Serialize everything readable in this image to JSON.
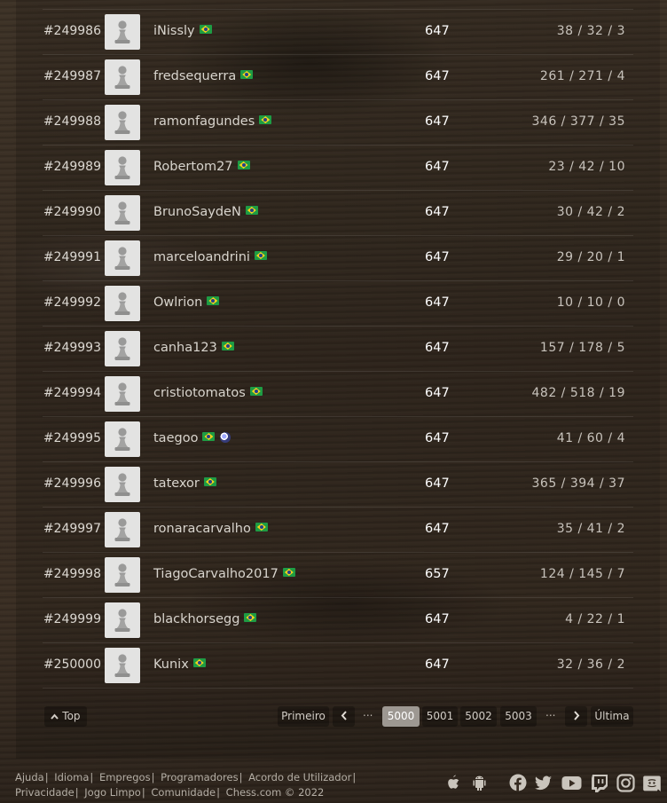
{
  "leaderboard": {
    "rows": [
      {
        "rank": "#249986",
        "username": "iNissly",
        "badge": false,
        "rating": "647",
        "record": "38 / 32 / 3"
      },
      {
        "rank": "#249987",
        "username": "fredsequerra",
        "badge": false,
        "rating": "647",
        "record": "261 / 271 / 4"
      },
      {
        "rank": "#249988",
        "username": "ramonfagundes",
        "badge": false,
        "rating": "647",
        "record": "346 / 377 / 35"
      },
      {
        "rank": "#249989",
        "username": "Robertom27",
        "badge": false,
        "rating": "647",
        "record": "23 / 42 / 10"
      },
      {
        "rank": "#249990",
        "username": "BrunoSaydeN",
        "badge": false,
        "rating": "647",
        "record": "30 / 42 / 2"
      },
      {
        "rank": "#249991",
        "username": "marceloandrini",
        "badge": false,
        "rating": "647",
        "record": "29 / 20 / 1"
      },
      {
        "rank": "#249992",
        "username": "Owlrion",
        "badge": false,
        "rating": "647",
        "record": "10 / 10 / 0"
      },
      {
        "rank": "#249993",
        "username": "canha123",
        "badge": false,
        "rating": "647",
        "record": "157 / 178 / 5"
      },
      {
        "rank": "#249994",
        "username": "cristiotomatos",
        "badge": false,
        "rating": "647",
        "record": "482 / 518 / 19"
      },
      {
        "rank": "#249995",
        "username": "taegoo",
        "badge": true,
        "rating": "647",
        "record": "41 / 60 / 4"
      },
      {
        "rank": "#249996",
        "username": "tatexor",
        "badge": false,
        "rating": "647",
        "record": "365 / 394 / 37"
      },
      {
        "rank": "#249997",
        "username": "ronaracarvalho",
        "badge": false,
        "rating": "647",
        "record": "35 / 41 / 2"
      },
      {
        "rank": "#249998",
        "username": "TiagoCarvalho2017",
        "badge": false,
        "rating": "657",
        "record": "124 / 145 / 7"
      },
      {
        "rank": "#249999",
        "username": "blackhorsegg",
        "badge": false,
        "rating": "647",
        "record": "4 / 22 / 1"
      },
      {
        "rank": "#250000",
        "username": "Kunix",
        "badge": false,
        "rating": "647",
        "record": "32 / 36 / 2"
      }
    ],
    "flag_icon": "brazil-flag-icon",
    "avatar_icon": "pawn-avatar-icon"
  },
  "pagination": {
    "top_label": "Top",
    "first_label": "Primeiro",
    "last_label": "Última",
    "ellipsis": "...",
    "pages": [
      "5000",
      "5001",
      "5002",
      "5003"
    ],
    "current_page": "5000"
  },
  "footer": {
    "line1": [
      "Ajuda",
      "Idioma",
      "Empregos",
      "Programadores",
      "Acordo de Utilizador"
    ],
    "line2": [
      "Privacidade",
      "Jogo Limpo",
      "Comunidade"
    ],
    "copyright": "Chess.com © 2022",
    "separator": "|",
    "social_icons": [
      "apple-icon",
      "android-icon",
      "facebook-icon",
      "twitter-icon",
      "youtube-icon",
      "twitch-icon",
      "instagram-icon",
      "discord-icon"
    ]
  },
  "colors": {
    "background": "#362b21",
    "active_page": "#9d9892",
    "flag_green": "#1e9c44",
    "flag_yellow": "#f5d21c",
    "flag_blue": "#23408e"
  }
}
